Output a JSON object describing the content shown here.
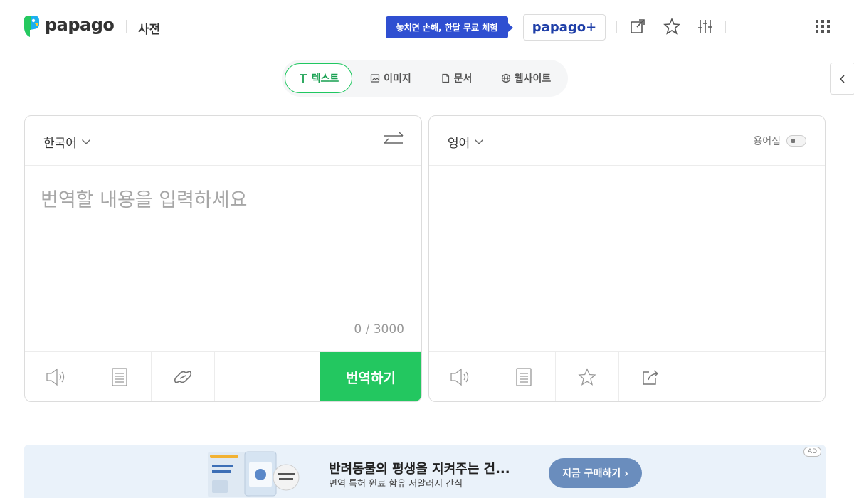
{
  "header": {
    "logo_text": "papago",
    "dict_label": "사전",
    "promo_text": "놓치면 손해, 한달 무료 체험",
    "plus_label": "papago+"
  },
  "tabs": [
    {
      "label": "텍스트",
      "icon": "text-icon",
      "active": true
    },
    {
      "label": "이미지",
      "icon": "image-icon"
    },
    {
      "label": "문서",
      "icon": "document-icon"
    },
    {
      "label": "웹사이트",
      "icon": "globe-icon"
    }
  ],
  "source": {
    "language": "한국어",
    "placeholder": "번역할 내용을 입력하세요",
    "value": "",
    "char_count": "0 / 3000",
    "translate_label": "번역하기"
  },
  "target": {
    "language": "영어",
    "glossary_label": "용어집"
  },
  "ad": {
    "title": "반려동물의 평생을 지켜주는 건...",
    "description": "면역 특허 원료 함유 저알러지 간식",
    "cta": "지금 구매하기 ›",
    "badge": "AD"
  },
  "colors": {
    "accent_green": "#23c760",
    "promo_blue": "#2f4fd1",
    "ad_background": "#eaf2fa"
  }
}
